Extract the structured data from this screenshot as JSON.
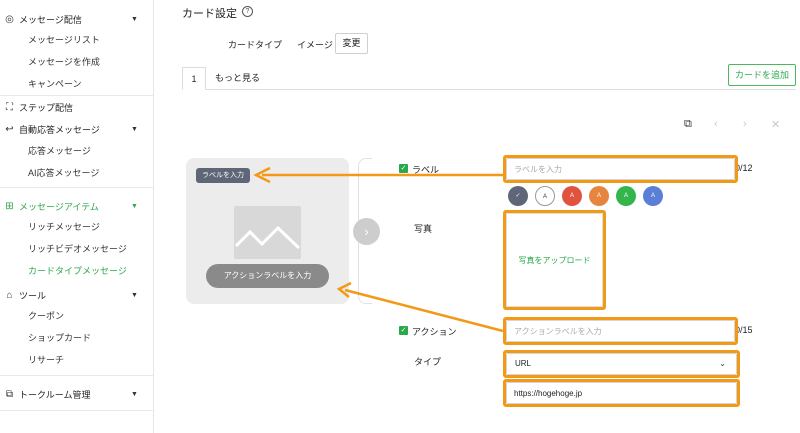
{
  "sidebar": {
    "sections": [
      {
        "label": "メッセージ配信",
        "icon": "broadcast-icon",
        "items": [
          "メッセージリスト",
          "メッセージを作成",
          "キャンペーン"
        ]
      },
      {
        "label": "ステップ配信",
        "icon": "step-icon",
        "items": []
      },
      {
        "label": "自動応答メッセージ",
        "icon": "reply-icon",
        "items": [
          "応答メッセージ",
          "AI応答メッセージ"
        ]
      },
      {
        "label": "メッセージアイテム",
        "icon": "plus-square-icon",
        "items": [
          "リッチメッセージ",
          "リッチビデオメッセージ",
          "カードタイプメッセージ"
        ]
      },
      {
        "label": "ツール",
        "icon": "store-icon",
        "items": [
          "クーポン",
          "ショップカード",
          "リサーチ"
        ]
      },
      {
        "label": "トークルーム管理",
        "icon": "room-icon",
        "items": []
      }
    ],
    "active_item": "カードタイプメッセージ",
    "active_color": "#2aa84a"
  },
  "page": {
    "title": "カード設定",
    "card_type_label": "カードタイプ",
    "card_type_value": "イメージ",
    "change_button": "変更"
  },
  "tabs": [
    "1",
    "もっと見る"
  ],
  "add_card_button": "カードを追加",
  "preview": {
    "label_pill": "ラベルを入力",
    "action_pill": "アクションラベルを入力"
  },
  "form": {
    "label_field": {
      "label": "ラベル",
      "placeholder": "ラベルを入力",
      "counter": "0/12"
    },
    "colors": [
      "#5e6678",
      "#ffffff",
      "#e0533f",
      "#e6853e",
      "#33b54a",
      "#5b7fd6"
    ],
    "swatch_letters": [
      "✓",
      "A",
      "A",
      "A",
      "A",
      "A"
    ],
    "photo": {
      "label": "写真",
      "upload": "写真をアップロード"
    },
    "action_field": {
      "label": "アクション",
      "placeholder": "アクションラベルを入力",
      "counter": "0/15"
    },
    "type": {
      "label": "タイプ",
      "value": "URL"
    },
    "url_value": "https://hogehoge.jp"
  },
  "highlight_color": "#f29a17"
}
